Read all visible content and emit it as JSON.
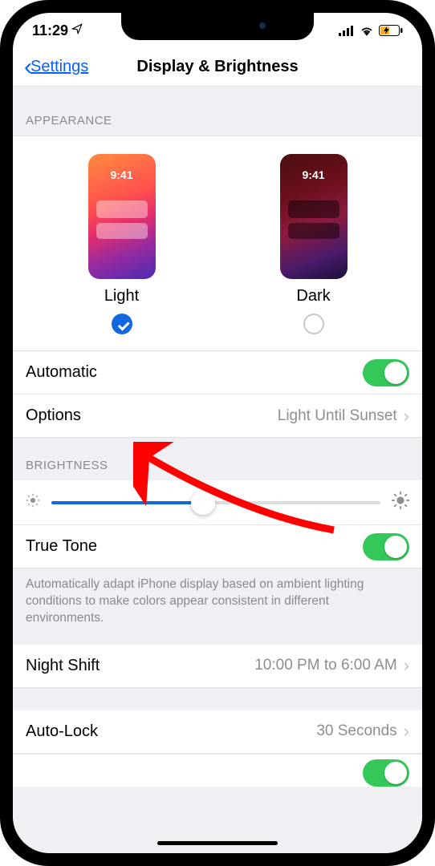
{
  "status": {
    "time": "11:29",
    "location_icon": "location-arrow"
  },
  "nav": {
    "back_label": "Settings",
    "title": "Display & Brightness"
  },
  "sections": {
    "appearance_header": "APPEARANCE",
    "brightness_header": "BRIGHTNESS"
  },
  "appearance": {
    "preview_time": "9:41",
    "modes": [
      {
        "label": "Light",
        "selected": true
      },
      {
        "label": "Dark",
        "selected": false
      }
    ],
    "automatic_label": "Automatic",
    "automatic_on": true,
    "options_label": "Options",
    "options_value": "Light Until Sunset"
  },
  "brightness": {
    "slider_value": 0.46,
    "true_tone_label": "True Tone",
    "true_tone_on": true,
    "true_tone_footer": "Automatically adapt iPhone display based on ambient lighting conditions to make colors appear consistent in different environments."
  },
  "night_shift": {
    "label": "Night Shift",
    "value": "10:00 PM to 6:00 AM"
  },
  "auto_lock": {
    "label": "Auto-Lock",
    "value": "30 Seconds"
  },
  "annotation": {
    "type": "arrow",
    "color": "#ff0000",
    "points_to": "options-row"
  }
}
